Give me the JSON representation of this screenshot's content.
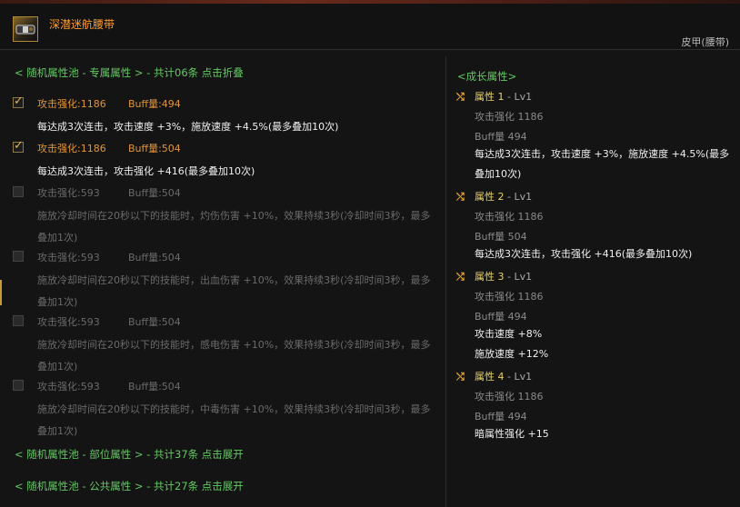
{
  "item": {
    "name": "深潜迷航腰带",
    "type": "皮甲(腰带)",
    "icon": "belt-icon",
    "name_color": "#ff9d2a"
  },
  "left": {
    "pool_exclusive": "< 随机属性池 - 专属属性 > - 共计06条 点击折叠",
    "options": [
      {
        "checked": true,
        "stat1": "攻击强化:1186",
        "stat2": "Buff量:494",
        "desc": "每达成3次连击，攻击速度 +3%，施放速度 +4.5%(最多叠加10次)"
      },
      {
        "checked": true,
        "stat1": "攻击强化:1186",
        "stat2": "Buff量:504",
        "desc": "每达成3次连击，攻击强化 +416(最多叠加10次)"
      },
      {
        "checked": false,
        "stat1": "攻击强化:593",
        "stat2": "Buff量:504",
        "desc": "施放冷却时间在20秒以下的技能时，灼伤伤害 +10%，效果持续3秒(冷却时间3秒，最多叠加1次)"
      },
      {
        "checked": false,
        "stat1": "攻击强化:593",
        "stat2": "Buff量:504",
        "desc": "施放冷却时间在20秒以下的技能时，出血伤害 +10%，效果持续3秒(冷却时间3秒，最多叠加1次)"
      },
      {
        "checked": false,
        "stat1": "攻击强化:593",
        "stat2": "Buff量:504",
        "desc": "施放冷却时间在20秒以下的技能时，感电伤害 +10%，效果持续3秒(冷却时间3秒，最多叠加1次)"
      },
      {
        "checked": false,
        "stat1": "攻击强化:593",
        "stat2": "Buff量:504",
        "desc": "施放冷却时间在20秒以下的技能时，中毒伤害 +10%，效果持续3秒(冷却时间3秒，最多叠加1次)"
      }
    ],
    "pool_slot": "< 随机属性池 - 部位属性 > - 共计37条 点击展开",
    "pool_common": "< 随机属性池 - 公共属性 > - 共计27条 点击展开"
  },
  "right": {
    "title": "<成长属性>",
    "attributes": [
      {
        "name": "属性 1",
        "level": "- Lv1",
        "sub1": "攻击强化 1186",
        "sub2": "Buff量 494",
        "effects": [
          "每达成3次连击，攻击速度 +3%，施放速度 +4.5%(最多叠加10次)"
        ]
      },
      {
        "name": "属性 2",
        "level": "- Lv1",
        "sub1": "攻击强化 1186",
        "sub2": "Buff量 504",
        "effects": [
          "每达成3次连击，攻击强化 +416(最多叠加10次)"
        ]
      },
      {
        "name": "属性 3",
        "level": "- Lv1",
        "sub1": "攻击强化 1186",
        "sub2": "Buff量 494",
        "effects": [
          "攻击速度 +8%",
          "施放速度 +12%"
        ]
      },
      {
        "name": "属性 4",
        "level": "- Lv1",
        "sub1": "攻击强化 1186",
        "sub2": "Buff量 494",
        "effects": [
          "暗属性强化 +15"
        ]
      }
    ]
  },
  "colors": {
    "accent_green": "#64c864",
    "checked_stat": "#e0953a",
    "attr_header": "#e8d26a"
  }
}
